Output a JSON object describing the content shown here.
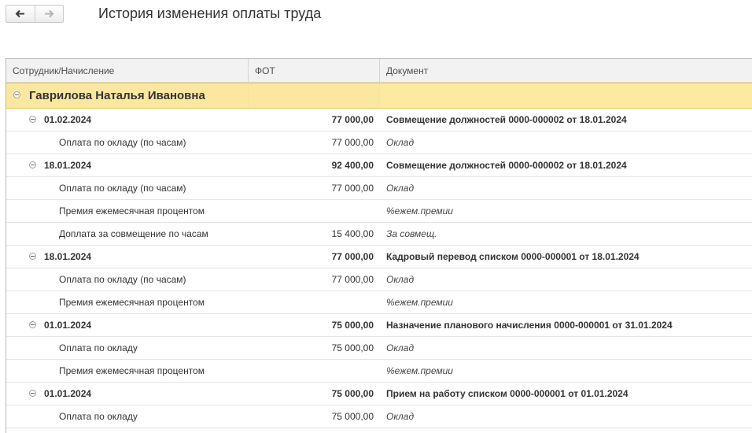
{
  "window": {
    "title": "История изменения оплаты труда"
  },
  "nav": {
    "back_icon": "arrow-left-icon",
    "forward_icon": "arrow-right-icon"
  },
  "table": {
    "columns": [
      "Сотрудник/Начисление",
      "ФОТ",
      "Документ"
    ],
    "employee": "Гаврилова Наталья Ивановна",
    "rows": [
      {
        "type": "date",
        "label": "01.02.2024",
        "fot": "77 000,00",
        "doc": "Совмещение должностей 0000-000002 от 18.01.2024"
      },
      {
        "type": "item",
        "label": "Оплата по окладу (по часам)",
        "fot": "77 000,00",
        "doc": "Оклад"
      },
      {
        "type": "date",
        "label": "18.01.2024",
        "fot": "92 400,00",
        "doc": "Совмещение должностей 0000-000002 от 18.01.2024"
      },
      {
        "type": "item",
        "label": "Оплата по окладу (по часам)",
        "fot": "77 000,00",
        "doc": "Оклад"
      },
      {
        "type": "item",
        "label": "Премия ежемесячная процентом",
        "fot": "",
        "doc": "%ежем.премии"
      },
      {
        "type": "item",
        "label": "Доплата за совмещение по часам",
        "fot": "15 400,00",
        "doc": "За совмещ."
      },
      {
        "type": "date",
        "label": "18.01.2024",
        "fot": "77 000,00",
        "doc": "Кадровый перевод списком 0000-000001 от 18.01.2024"
      },
      {
        "type": "item",
        "label": "Оплата по окладу (по часам)",
        "fot": "77 000,00",
        "doc": "Оклад"
      },
      {
        "type": "item",
        "label": "Премия ежемесячная процентом",
        "fot": "",
        "doc": "%ежем.премии"
      },
      {
        "type": "date",
        "label": "01.01.2024",
        "fot": "75 000,00",
        "doc": "Назначение планового начисления 0000-000001 от 31.01.2024"
      },
      {
        "type": "item",
        "label": "Оплата по окладу",
        "fot": "75 000,00",
        "doc": "Оклад"
      },
      {
        "type": "item",
        "label": "Премия ежемесячная процентом",
        "fot": "",
        "doc": "%ежем.премии"
      },
      {
        "type": "date",
        "label": "01.01.2024",
        "fot": "75 000,00",
        "doc": "Прием на работу списком 0000-000001 от 01.01.2024"
      },
      {
        "type": "item",
        "label": "Оплата по окладу",
        "fot": "75 000,00",
        "doc": "Оклад"
      }
    ]
  }
}
